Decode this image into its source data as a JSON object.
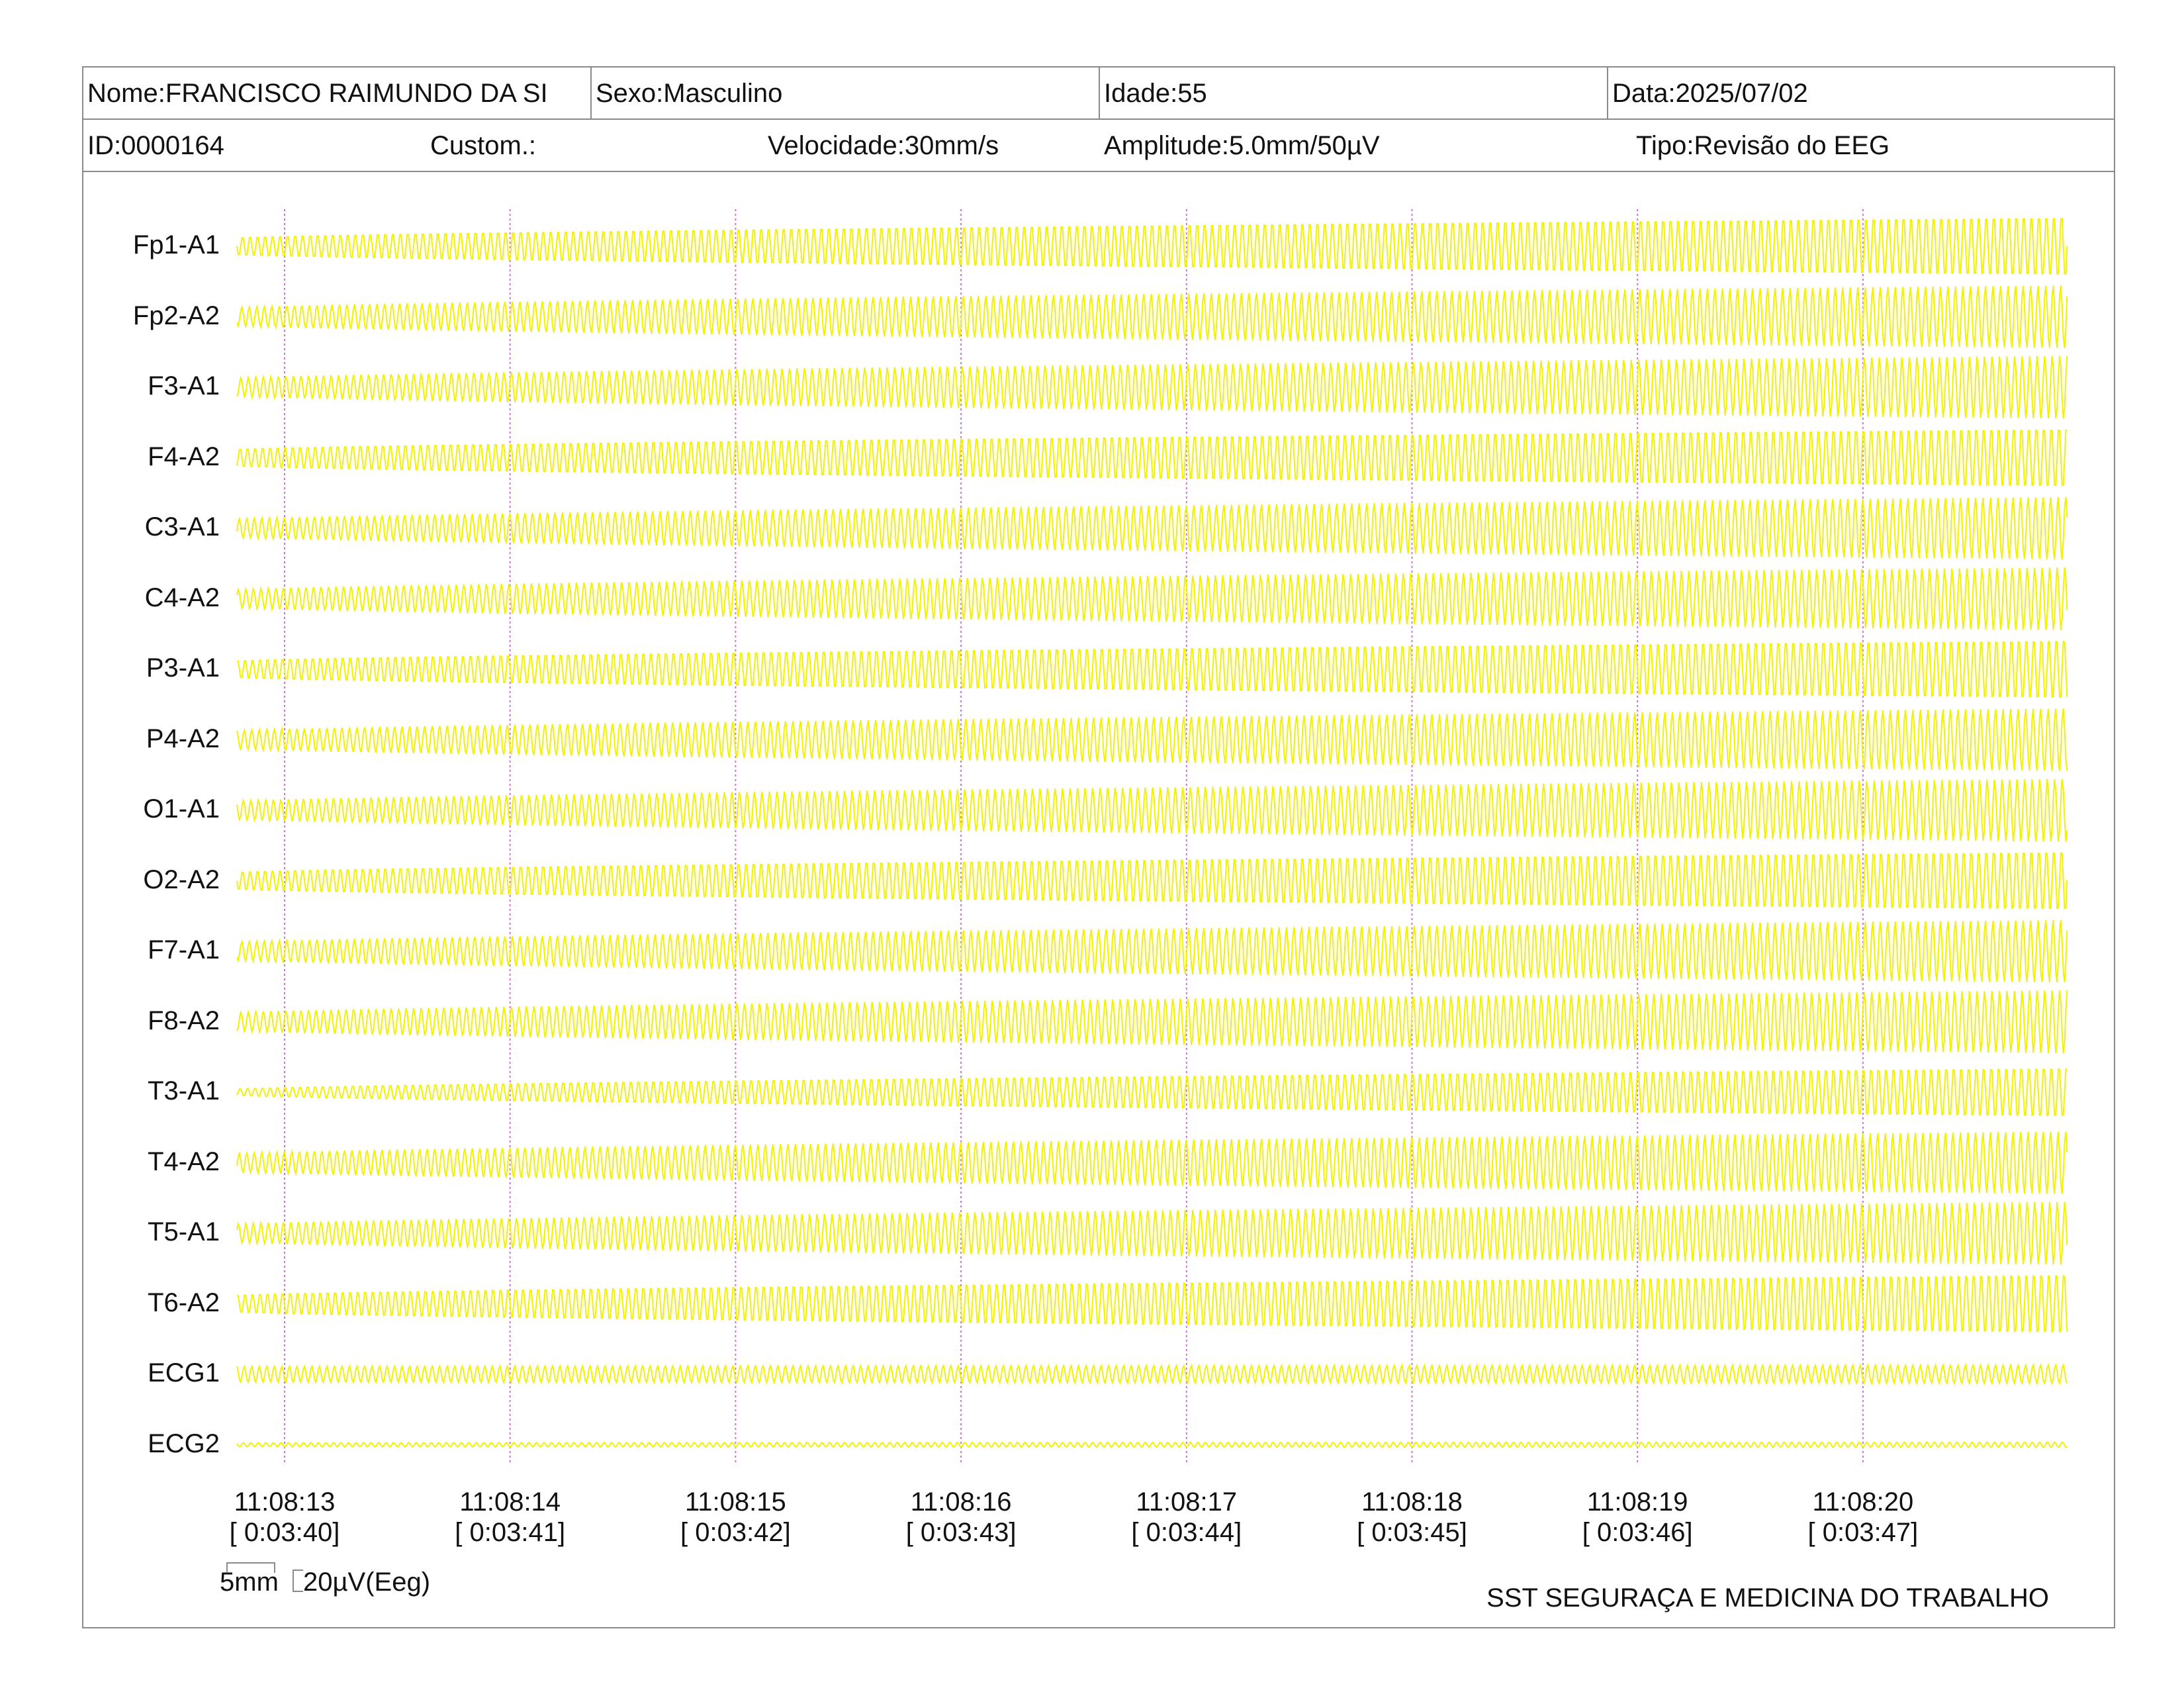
{
  "header": {
    "row1": [
      {
        "id": "name",
        "text": "Nome:FRANCISCO RAIMUNDO DA SI"
      },
      {
        "id": "sex",
        "text": "Sexo:Masculino"
      },
      {
        "id": "age",
        "text": "Idade:55"
      },
      {
        "id": "date",
        "text": "Data:2025/07/02"
      }
    ],
    "row2": [
      {
        "id": "id",
        "text": "ID:0000164"
      },
      {
        "id": "custom",
        "text": "Custom.:"
      },
      {
        "id": "speed",
        "text": "Velocidade:30mm/s"
      },
      {
        "id": "amplitude",
        "text": "Amplitude:5.0mm/50µV"
      },
      {
        "id": "type",
        "text": "Tipo:Revisão do EEG"
      }
    ]
  },
  "channels": [
    "Fp1-A1",
    "Fp2-A2",
    "F3-A1",
    "F4-A2",
    "C3-A1",
    "C4-A2",
    "P3-A1",
    "P4-A2",
    "O1-A1",
    "O2-A2",
    "F7-A1",
    "F8-A2",
    "T3-A1",
    "T4-A2",
    "T5-A1",
    "T6-A2",
    "ECG1",
    "ECG2"
  ],
  "time_marks": [
    {
      "clock": "11:08:13",
      "elapsed": "[ 0:03:40]"
    },
    {
      "clock": "11:08:14",
      "elapsed": "[ 0:03:41]"
    },
    {
      "clock": "11:08:15",
      "elapsed": "[ 0:03:42]"
    },
    {
      "clock": "11:08:16",
      "elapsed": "[ 0:03:43]"
    },
    {
      "clock": "11:08:17",
      "elapsed": "[ 0:03:44]"
    },
    {
      "clock": "11:08:18",
      "elapsed": "[ 0:03:45]"
    },
    {
      "clock": "11:08:19",
      "elapsed": "[ 0:03:46]"
    },
    {
      "clock": "11:08:20",
      "elapsed": "[ 0:03:47]"
    }
  ],
  "scale": {
    "time": "5mm",
    "amplitude": "20µV(Eeg)"
  },
  "footer": "SST SEGURAÇA E MEDICINA DO TRABALHO",
  "colors": {
    "trace": "#f2f200",
    "marker": "#d070d0",
    "border": "#8a8a8a"
  }
}
